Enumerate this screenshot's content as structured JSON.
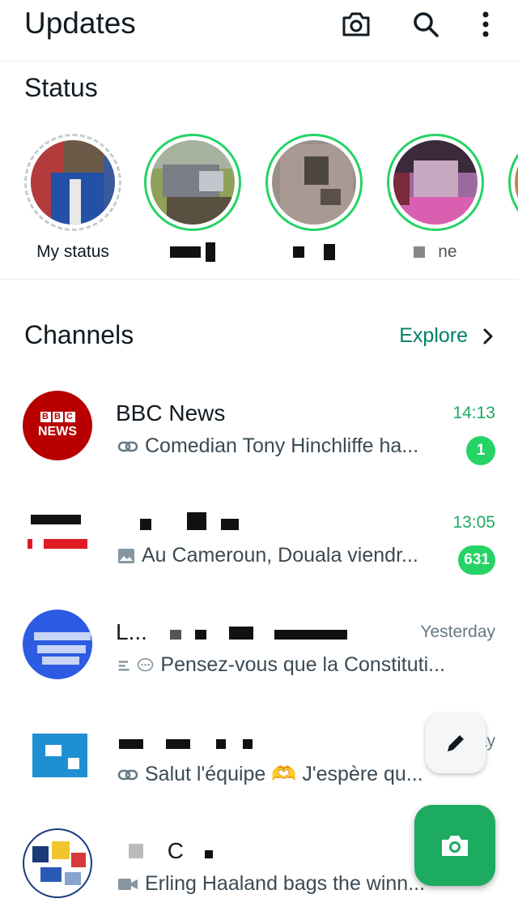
{
  "header": {
    "title": "Updates",
    "icons": [
      "camera-icon",
      "search-icon",
      "more-vert-icon"
    ]
  },
  "status": {
    "section_title": "Status",
    "items": [
      {
        "name": "My status",
        "is_mine": true
      },
      {
        "name": "",
        "is_mine": false
      },
      {
        "name": "",
        "is_mine": false
      },
      {
        "name": "ne",
        "is_mine": false
      }
    ]
  },
  "channels": {
    "section_title": "Channels",
    "explore_label": "Explore",
    "items": [
      {
        "name": "BBC News",
        "time": "14:13",
        "message": "Comedian Tony Hinchliffe ha...",
        "message_icon": "link-icon",
        "unread": "1"
      },
      {
        "name": "",
        "time": "13:05",
        "message": "Au Cameroun, Douala viendr...",
        "message_icon": "image-icon",
        "unread": "631"
      },
      {
        "name": "L...",
        "time": "Yesterday",
        "message": "Pensez-vous que la Constituti...",
        "message_icon": "poll-icon",
        "unread": ""
      },
      {
        "name": "",
        "time": "Y...ay",
        "message": "Salut l'équipe 🫶 J'espère qu...",
        "message_icon": "link-icon",
        "unread": ""
      },
      {
        "name": "C",
        "time": "",
        "message": "Erling Haaland bags the winn...",
        "message_icon": "video-icon",
        "unread": ""
      }
    ]
  },
  "bbc_logo": {
    "line1": "BBC",
    "line2": "NEWS"
  },
  "colors": {
    "accent": "#008069",
    "badge": "#25d366",
    "fab": "#1daa61",
    "bbc_red": "#b80000"
  }
}
